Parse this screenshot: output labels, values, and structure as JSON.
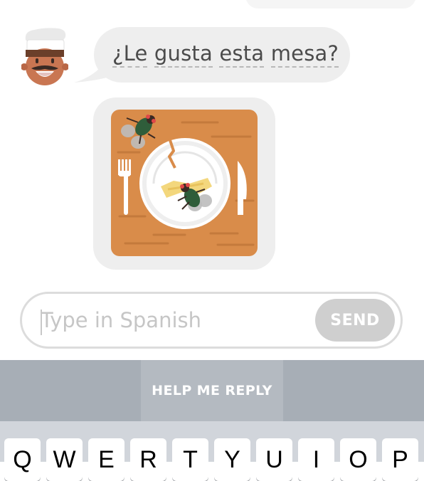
{
  "conversation": {
    "message_words": [
      "¿Le",
      "gusta",
      "esta",
      "mesa?"
    ]
  },
  "reply": {
    "placeholder": "Type in Spanish",
    "send_label": "SEND"
  },
  "help": {
    "label": "HELP ME REPLY"
  },
  "keyboard": {
    "keys": [
      "Q",
      "W",
      "E",
      "R",
      "T",
      "Y",
      "U",
      "I",
      "O",
      "P"
    ]
  },
  "colors": {
    "bubble": "#eeeeee",
    "table_wood": "#d98c4a",
    "send_disabled": "#cfcfcf",
    "help_bar": "#a7aeb6",
    "keyboard_bg": "#d1d5db"
  },
  "icons": [
    "chef-avatar-icon",
    "dirty-table-with-flies-illustration"
  ]
}
